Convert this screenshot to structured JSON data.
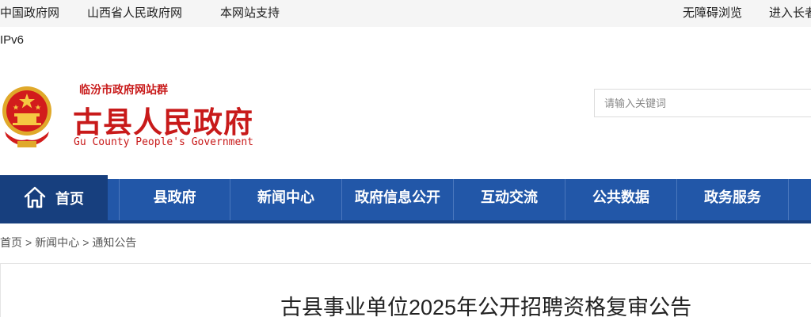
{
  "topbar": {
    "left_links": [
      "中国政府网",
      "山西省人民政府网",
      "本网站支持"
    ],
    "right_links": [
      "无障碍浏览",
      "进入长者"
    ]
  },
  "ipv6": "IPv6",
  "header": {
    "site_group": "临汾市政府网站群",
    "title": "古县人民政府",
    "title_en": "Gu County People's Government",
    "search_placeholder": "请输入关键词"
  },
  "nav": {
    "home": "首页",
    "items": [
      "县政府",
      "新闻中心",
      "政府信息公开",
      "互动交流",
      "公共数据",
      "政务服务"
    ]
  },
  "breadcrumb": [
    "首页",
    "新闻中心",
    "通知公告"
  ],
  "breadcrumb_sep": ">",
  "article": {
    "title": "古县事业单位2025年公开招聘资格复审公告"
  },
  "colors": {
    "brand_red": "#c81a1a",
    "nav_blue": "#2257a8",
    "nav_dark": "#173f7e"
  }
}
